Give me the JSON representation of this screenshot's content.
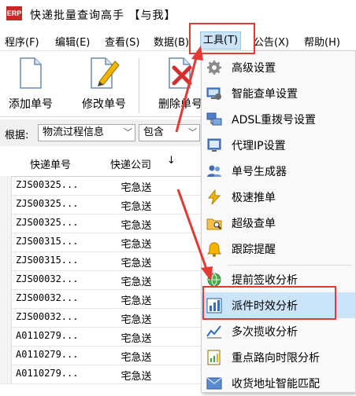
{
  "window": {
    "icon_text": "ERP",
    "title": "快递批量查询高手 【与我】"
  },
  "menubar": {
    "items": [
      {
        "key": "program",
        "label": "程序(F)"
      },
      {
        "key": "edit",
        "label": "编辑(E)"
      },
      {
        "key": "view",
        "label": "查看(S)"
      },
      {
        "key": "data",
        "label": "数据(B)"
      },
      {
        "key": "tools",
        "label": "工具(T)"
      },
      {
        "key": "notice",
        "label": "公告(X)"
      },
      {
        "key": "help",
        "label": "帮助(H)"
      }
    ]
  },
  "toolbar": {
    "add_label": "添加单号",
    "modify_label": "修改单号",
    "delete_label": "删除单号"
  },
  "filter": {
    "label": "根据:",
    "field_value": "物流过程信息",
    "mode_value": "包含"
  },
  "grid": {
    "columns": [
      "快递单号",
      "快递公司"
    ],
    "sort_indicator": "↓",
    "rows": [
      {
        "no": "ZJS00325...",
        "company": "宅急送"
      },
      {
        "no": "ZJS00325...",
        "company": "宅急送"
      },
      {
        "no": "ZJS00325...",
        "company": "宅急送"
      },
      {
        "no": "ZJS00315...",
        "company": "宅急送"
      },
      {
        "no": "ZJS00315...",
        "company": "宅急送"
      },
      {
        "no": "ZJS00032...",
        "company": "宅急送"
      },
      {
        "no": "ZJS00032...",
        "company": "宅急送"
      },
      {
        "no": "ZJS00032...",
        "company": "宅急送"
      },
      {
        "no": "A0110279...",
        "company": "宅急送"
      },
      {
        "no": "A0110279...",
        "company": "宅急送"
      },
      {
        "no": "A0110279...",
        "company": "宅急送"
      }
    ]
  },
  "tools_menu": {
    "items": [
      {
        "label": "高级设置",
        "icon": "gear-icon"
      },
      {
        "label": "智能查单设置",
        "icon": "monitor-settings-icon"
      },
      {
        "label": "ADSL重拨号设置",
        "icon": "network-icon"
      },
      {
        "label": "代理IP设置",
        "icon": "proxy-icon"
      },
      {
        "label": "单号生成器",
        "icon": "people-icon"
      },
      {
        "label": "极速推单",
        "icon": "lightning-icon"
      },
      {
        "label": "超级查单",
        "icon": "folder-search-icon"
      },
      {
        "label": "跟踪提醒",
        "icon": "bell-icon"
      },
      {
        "label": "提前签收分析",
        "icon": "globe-icon"
      },
      {
        "label": "派件时效分析",
        "icon": "bar-chart-icon"
      },
      {
        "label": "多次揽收分析",
        "icon": "line-chart-icon"
      },
      {
        "label": "重点路向时限分析",
        "icon": "document-chart-icon"
      },
      {
        "label": "收货地址智能匹配",
        "icon": "address-icon"
      }
    ],
    "highlighted_item": "派件时效分析"
  },
  "colors": {
    "annotation": "#e53935",
    "menu_highlight": "#cce4f7"
  }
}
